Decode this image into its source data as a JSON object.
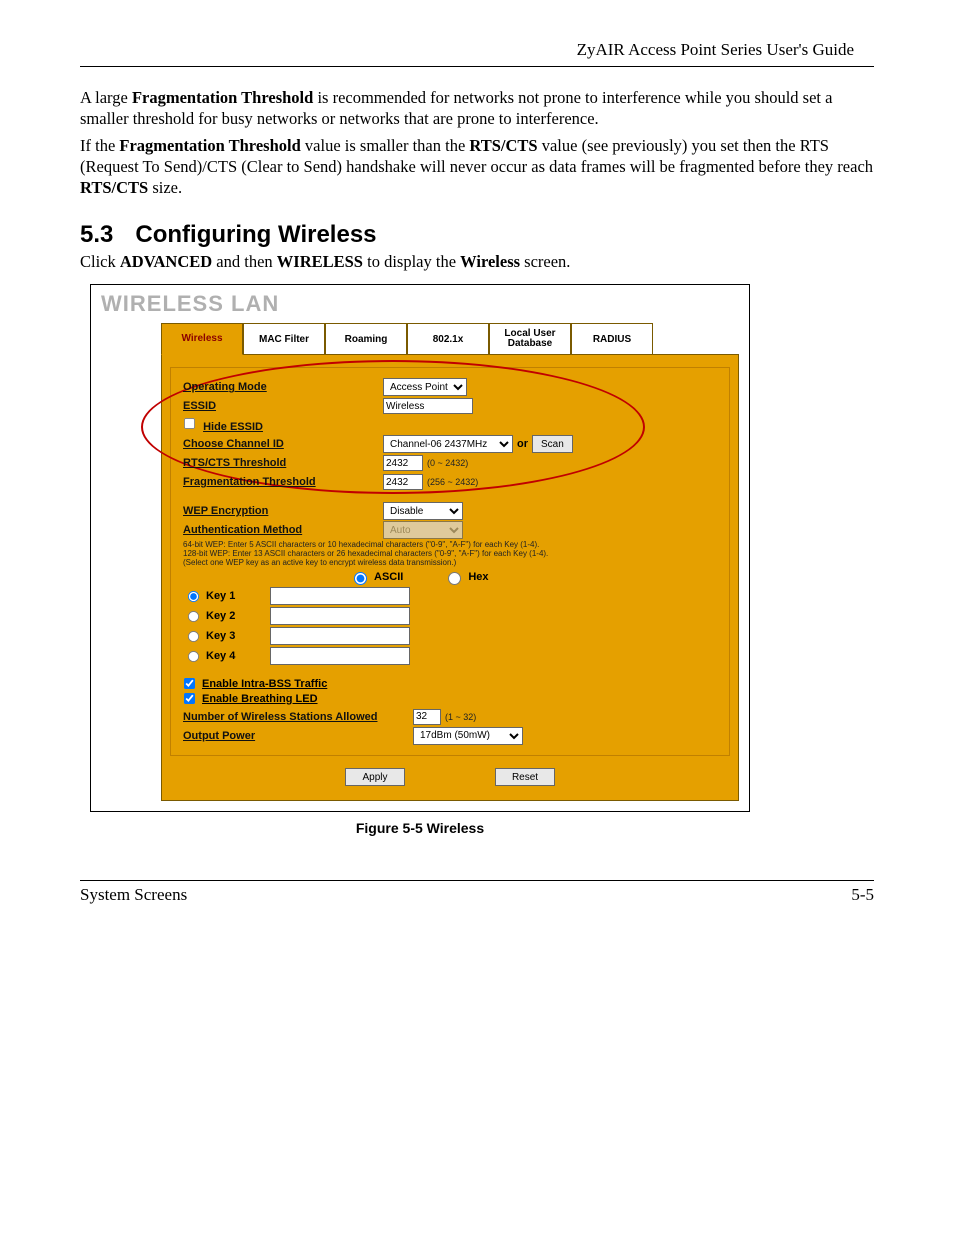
{
  "header": {
    "guide_title": "ZyAIR Access Point Series User's Guide"
  },
  "body": {
    "para1_a": "A large ",
    "para1_b": "Fragmentation Threshold",
    "para1_c": " is recommended for networks not prone to interference while you should set a smaller threshold for busy networks or networks that are prone to interference.",
    "para2_a": "If the ",
    "para2_b": "Fragmentation Threshold",
    "para2_c": " value is smaller than the ",
    "para2_d": "RTS/CTS",
    "para2_e": " value (see previously) you set then the RTS (Request To Send)/CTS (Clear to Send) handshake will never occur as data frames will be fragmented before they reach ",
    "para2_f": "RTS/CTS",
    "para2_g": " size."
  },
  "section": {
    "num": "5.3",
    "title": "Configuring Wireless",
    "intro_a": "Click ",
    "intro_b": "ADVANCED",
    "intro_c": " and then ",
    "intro_d": "WIRELESS",
    "intro_e": " to display the ",
    "intro_f": "Wireless",
    "intro_g": " screen."
  },
  "shot": {
    "title": "WIRELESS LAN",
    "tabs": [
      "Wireless",
      "MAC Filter",
      "Roaming",
      "802.1x",
      "Local User Database",
      "RADIUS"
    ],
    "labels": {
      "op_mode": "Operating Mode",
      "essid": "ESSID",
      "hide_essid": "Hide ESSID",
      "channel": "Choose Channel ID",
      "rtscts": "RTS/CTS Threshold",
      "frag": "Fragmentation Threshold",
      "wep": "WEP Encryption",
      "auth": "Authentication Method",
      "ascii": "ASCII",
      "hex": "Hex",
      "k1": "Key 1",
      "k2": "Key 2",
      "k3": "Key 3",
      "k4": "Key 4",
      "intra": "Enable Intra-BSS Traffic",
      "led": "Enable Breathing LED",
      "stations": "Number of Wireless Stations Allowed",
      "power": "Output Power",
      "apply": "Apply",
      "reset": "Reset",
      "or": "or",
      "scan": "Scan"
    },
    "values": {
      "op_mode": "Access Point",
      "essid": "Wireless",
      "channel": "Channel-06 2437MHz",
      "rtscts": "2432",
      "rtscts_range": "(0 ~ 2432)",
      "frag": "2432",
      "frag_range": "(256 ~ 2432)",
      "wep": "Disable",
      "auth": "Auto",
      "stations": "32",
      "stations_range": "(1 ~ 32)",
      "power": "17dBm (50mW)"
    },
    "wep_note_lines": [
      "64-bit WEP: Enter 5 ASCII characters or 10 hexadecimal characters (\"0-9\", \"A-F\") for each Key (1-4).",
      "128-bit WEP: Enter 13 ASCII characters or 26 hexadecimal characters (\"0-9\", \"A-F\") for each Key (1-4).",
      "(Select one WEP key as an active key to encrypt wireless data transmission.)"
    ]
  },
  "figcaption": "Figure 5-5 Wireless",
  "footer": {
    "left": "System Screens",
    "right": "5-5"
  }
}
